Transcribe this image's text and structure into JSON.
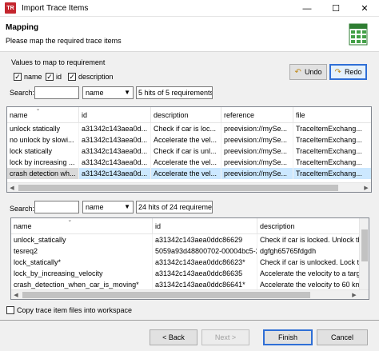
{
  "window": {
    "title": "Import Trace Items",
    "app_icon_text": "TR",
    "minimize": "—",
    "maximize": "☐",
    "close": "✕"
  },
  "header": {
    "title": "Mapping",
    "subtitle": "Please map the required trace items"
  },
  "values_label": "Values to map to requirement",
  "checkboxes": [
    {
      "label": "name",
      "checked": true
    },
    {
      "label": "id",
      "checked": true
    },
    {
      "label": "description",
      "checked": true
    }
  ],
  "undo_label": "Undo",
  "redo_label": "Redo",
  "search1": {
    "label": "Search:",
    "value": "",
    "select_value": "name",
    "hits": "5 hits of 5 requirements"
  },
  "table1": {
    "columns": [
      "name",
      "id",
      "description",
      "reference",
      "file"
    ],
    "rows": [
      [
        "unlock statically",
        "a31342c143aea0d...",
        "Check if car is loc...",
        "preevision://mySe...",
        "TraceItemExchang..."
      ],
      [
        "no unlock by slowi...",
        "a31342c143aea0d...",
        "Accelerate the vel...",
        "preevision://mySe...",
        "TraceItemExchang..."
      ],
      [
        "lock statically",
        "a31342c143aea0d...",
        "Check if car is unl...",
        "preevision://mySe...",
        "TraceItemExchang..."
      ],
      [
        "lock by increasing ...",
        "a31342c143aea0d...",
        "Accelerate the vel...",
        "preevision://mySe...",
        "TraceItemExchang..."
      ],
      [
        "crash detection wh...",
        "a31342c143aea0d...",
        "Accelerate the vel...",
        "preevision://mySe...",
        "TraceItemExchang..."
      ]
    ],
    "selected_row": 4
  },
  "search2": {
    "label": "Search:",
    "value": "",
    "select_value": "name",
    "hits": "24 hits of 24 requiremer"
  },
  "table2": {
    "columns": [
      "name",
      "id",
      "description"
    ],
    "rows": [
      [
        "unlock_statically",
        "a31342c143aea0ddc86629",
        "Check if car is locked. Unlock the"
      ],
      [
        "tesreq2",
        "5059a93d48800702-00004bc5-2",
        "dgfgh65765fdgdh"
      ],
      [
        "lock_statically*",
        "a31342c143aea0ddc86623*",
        "Check if car is unlocked. Lock th"
      ],
      [
        "lock_by_increasing_velocity",
        "a31342c143aea0ddc86635",
        "Accelerate the velocity to a targe"
      ],
      [
        "crash_detection_when_car_is_moving*",
        "a31342c143aea0ddc86641*",
        "Accelerate the velocity to 60 km/"
      ]
    ]
  },
  "copy_checkbox": {
    "label": "Copy trace item files into workspace",
    "checked": false
  },
  "footer": {
    "back": "< Back",
    "next": "Next >",
    "finish": "Finish",
    "cancel": "Cancel"
  }
}
